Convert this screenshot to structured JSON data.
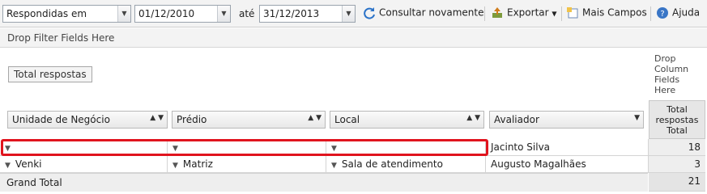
{
  "toolbar": {
    "date_field": "Respondidas em",
    "from_date": "01/12/2010",
    "until_label": "até",
    "to_date": "31/12/2013",
    "refresh_label": "Consultar novamente",
    "export_label": "Exportar",
    "more_fields_label": "Mais Campos",
    "help_label": "Ajuda"
  },
  "filter_zone": {
    "text": "Drop Filter Fields Here"
  },
  "data_zone": {
    "field_chip": "Total respostas"
  },
  "column_zone": {
    "text": "Drop Column Fields Here"
  },
  "row_fields": [
    {
      "label": "Unidade de Negócio",
      "controls": "▲ ▼"
    },
    {
      "label": "Prédio",
      "controls": "▲ ▼"
    },
    {
      "label": "Local",
      "controls": "▲ ▼"
    },
    {
      "label": "Avaliador",
      "controls": "▼"
    }
  ],
  "total_header": "Total respostas Total",
  "rows": [
    {
      "unidade": "",
      "predio": "",
      "local": "",
      "avaliador": "Jacinto Silva",
      "total": "18"
    },
    {
      "unidade": "Venki",
      "predio": "Matriz",
      "local": "Sala de atendimento",
      "avaliador": "Augusto Magalhães",
      "total": "3"
    }
  ],
  "grand_total": {
    "label": "Grand Total",
    "value": "21"
  },
  "icons": {
    "expand": "chevron-down-icon",
    "refresh": "refresh-icon",
    "export": "export-icon",
    "fields": "add-fields-icon",
    "help": "help-icon"
  },
  "colors": {
    "highlight": "#e0141e"
  }
}
